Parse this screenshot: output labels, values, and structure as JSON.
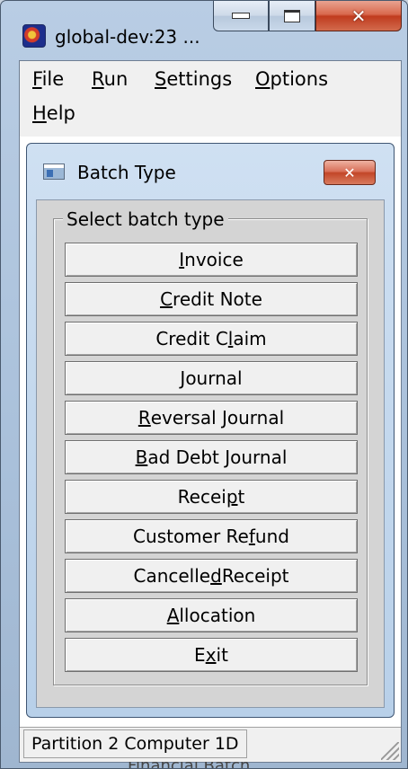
{
  "window": {
    "title": "global-dev:23 ...",
    "icon": "app-icon",
    "controls": {
      "minimize": "minimize-icon",
      "maximize": "maximize-icon",
      "close": "close-icon"
    }
  },
  "menubar": {
    "items": [
      {
        "pre": "",
        "key": "F",
        "post": "ile"
      },
      {
        "pre": "",
        "key": "R",
        "post": "un"
      },
      {
        "pre": "",
        "key": "S",
        "post": "ettings"
      },
      {
        "pre": "",
        "key": "O",
        "post": "ptions"
      },
      {
        "pre": "",
        "key": "H",
        "post": "elp"
      }
    ]
  },
  "background_text": "Financial Batch",
  "dialog": {
    "title": "Batch Type",
    "close_glyph": "✕",
    "group_label": "Select batch type",
    "buttons": [
      {
        "pre": "",
        "key": "I",
        "post": "nvoice"
      },
      {
        "pre": "",
        "key": "C",
        "post": "redit Note"
      },
      {
        "pre": "Credit C",
        "key": "l",
        "post": "aim"
      },
      {
        "pre": "",
        "key": "J",
        "post": "ournal"
      },
      {
        "pre": "",
        "key": "R",
        "post": "eversal Journal"
      },
      {
        "pre": "",
        "key": "B",
        "post": "ad Debt Journal"
      },
      {
        "pre": "Recei",
        "key": "p",
        "post": "t"
      },
      {
        "pre": "Customer Re",
        "key": "f",
        "post": "und"
      },
      {
        "pre": "Cancelle",
        "key": "d",
        "post": " Receipt"
      },
      {
        "pre": "",
        "key": "A",
        "post": "llocation"
      },
      {
        "pre": "E",
        "key": "x",
        "post": "it"
      }
    ]
  },
  "statusbar": {
    "text": "Partition 2 Computer 1D"
  },
  "colors": {
    "frame": "#b9cde4",
    "dialog_frame": "#cfe0f2",
    "close_red": "#c03b1e",
    "button_face": "#f0f0f0"
  }
}
